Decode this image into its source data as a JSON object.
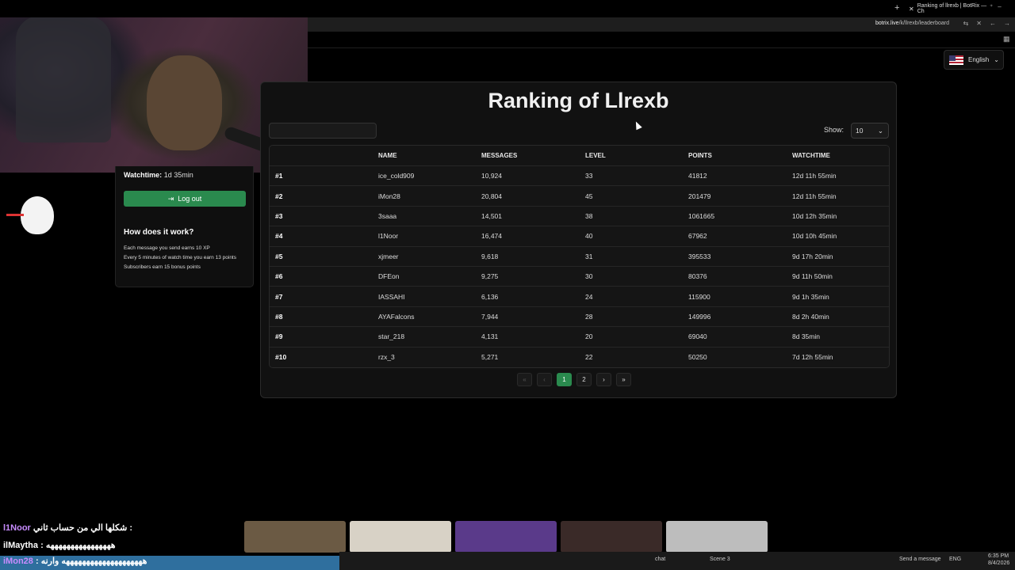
{
  "browser": {
    "tab_title": "Ranking of llrexb | BotRix — Ch",
    "url_host": "botrix.live",
    "url_path": "/k/llrexb/leaderboard"
  },
  "header": {
    "language": "English"
  },
  "sidebar": {
    "watchtime_label": "Watchtime:",
    "watchtime_value": "1d 35min",
    "logout_label": "Log out",
    "how_title": "How does it work?",
    "how_lines": [
      "Each message you send earns 10 XP",
      "Every 5 minutes of watch time you earn 13 points",
      "Subscribers earn 15 bonus points"
    ]
  },
  "main": {
    "title": "Ranking of Llrexb",
    "show_label": "Show:",
    "show_value": "10",
    "columns": [
      "",
      "NAME",
      "MESSAGES",
      "LEVEL",
      "POINTS",
      "WATCHTIME"
    ],
    "rows": [
      {
        "rank": "#1",
        "name": "ice_cold909",
        "messages": "10,924",
        "level": "33",
        "points": "41812",
        "watchtime": "12d 11h 55min"
      },
      {
        "rank": "#2",
        "name": "iMon28",
        "messages": "20,804",
        "level": "45",
        "points": "201479",
        "watchtime": "12d 11h 55min"
      },
      {
        "rank": "#3",
        "name": "3saaa",
        "messages": "14,501",
        "level": "38",
        "points": "1061665",
        "watchtime": "10d 12h 35min"
      },
      {
        "rank": "#4",
        "name": "l1Noor",
        "messages": "16,474",
        "level": "40",
        "points": "67962",
        "watchtime": "10d 10h 45min"
      },
      {
        "rank": "#5",
        "name": "xjmeer",
        "messages": "9,618",
        "level": "31",
        "points": "395533",
        "watchtime": "9d 17h 20min"
      },
      {
        "rank": "#6",
        "name": "DFEon",
        "messages": "9,275",
        "level": "30",
        "points": "80376",
        "watchtime": "9d 11h 50min"
      },
      {
        "rank": "#7",
        "name": "IASSAHI",
        "messages": "6,136",
        "level": "24",
        "points": "115900",
        "watchtime": "9d 1h 35min"
      },
      {
        "rank": "#8",
        "name": "AYAFalcons",
        "messages": "7,944",
        "level": "28",
        "points": "149996",
        "watchtime": "8d 2h 40min"
      },
      {
        "rank": "#9",
        "name": "star_218",
        "messages": "4,131",
        "level": "20",
        "points": "69040",
        "watchtime": "8d 35min"
      },
      {
        "rank": "#10",
        "name": "rzx_3",
        "messages": "5,271",
        "level": "22",
        "points": "50250",
        "watchtime": "7d 12h 55min"
      }
    ],
    "pagination": {
      "first": "«",
      "prev": "‹",
      "pages": [
        "1",
        "2"
      ],
      "current": "1",
      "next": "›",
      "last": "»"
    }
  },
  "overlay": {
    "chat": [
      {
        "user": "l1Noor",
        "text": "شكلها الي من حساب ثاني :"
      },
      {
        "user": "ilMaytha",
        "text": ": ههههههههههههههههه"
      },
      {
        "user": "iMon28",
        "text": ": ههههههههههههههههههههه وارنه"
      }
    ],
    "taskbar": {
      "chat_label": "chat",
      "scene_label": "Scene 3",
      "send_placeholder": "Send a message",
      "lang_indicator": "ENG",
      "time": "6:35 PM",
      "date": "8/4/2026"
    }
  }
}
